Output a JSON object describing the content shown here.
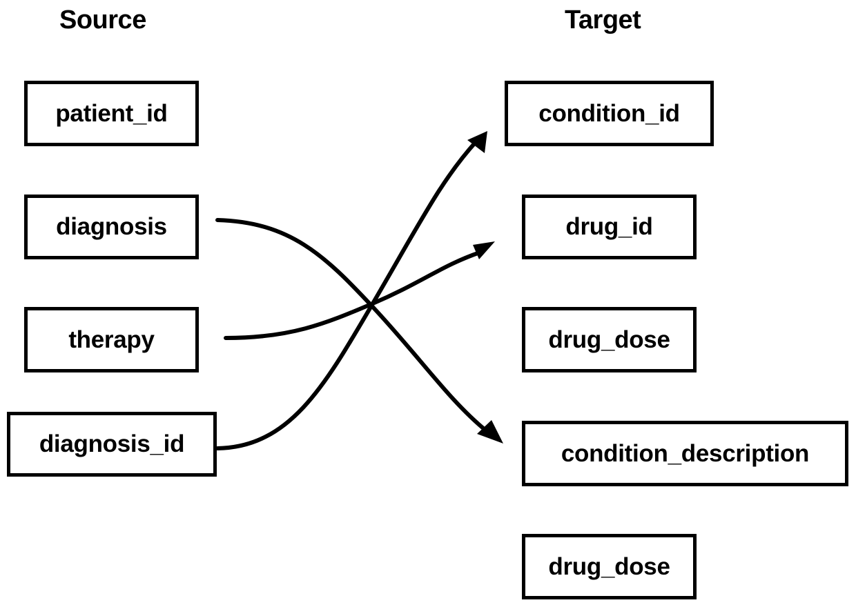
{
  "headings": {
    "source": "Source",
    "target": "Target"
  },
  "source_fields": [
    {
      "id": "src-patient-id",
      "label": "patient_id"
    },
    {
      "id": "src-diagnosis",
      "label": "diagnosis"
    },
    {
      "id": "src-therapy",
      "label": "therapy"
    },
    {
      "id": "src-diagnosis-id",
      "label": "diagnosis_id"
    }
  ],
  "target_fields": [
    {
      "id": "tgt-condition-id",
      "label": "condition_id"
    },
    {
      "id": "tgt-drug-id",
      "label": "drug_id"
    },
    {
      "id": "tgt-drug-dose",
      "label": "drug_dose"
    },
    {
      "id": "tgt-condition-description",
      "label": "condition_description"
    },
    {
      "id": "tgt-drug-dose-2",
      "label": "drug_dose"
    }
  ],
  "mappings": [
    {
      "from": "diagnosis",
      "to": "condition_description"
    },
    {
      "from": "therapy",
      "to": "drug_id"
    },
    {
      "from": "diagnosis_id",
      "to": "condition_id"
    }
  ],
  "colors": {
    "stroke": "#000000",
    "background": "#ffffff"
  }
}
